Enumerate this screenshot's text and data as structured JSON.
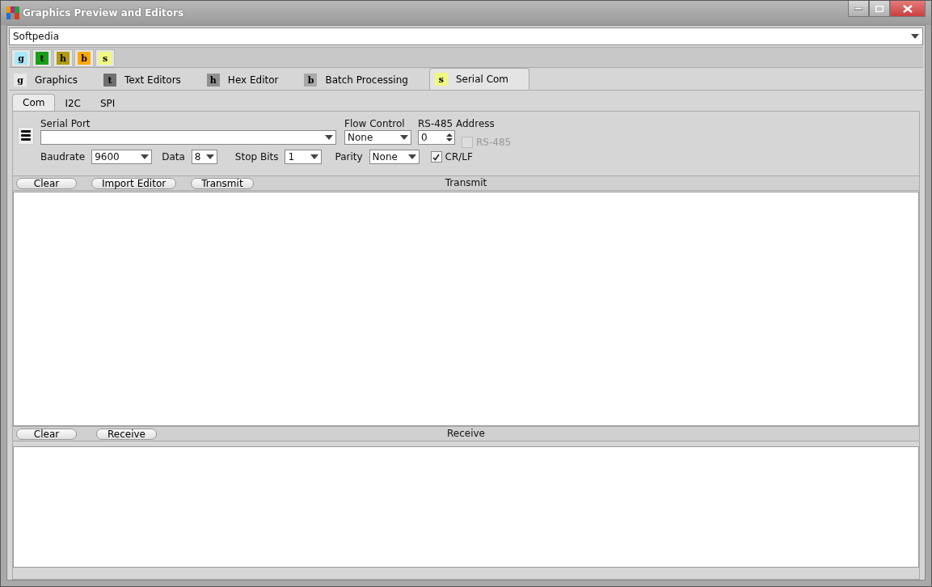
{
  "window": {
    "title": "Graphics Preview and Editors"
  },
  "profile": {
    "value": "Softpedia"
  },
  "toolbar": [
    {
      "letter": "g",
      "color": "#a8e8f8"
    },
    {
      "letter": "t",
      "color": "#18a018"
    },
    {
      "letter": "h",
      "color": "#b09a10"
    },
    {
      "letter": "b",
      "color": "#ffa800"
    },
    {
      "letter": "s",
      "color": "#f0f880"
    }
  ],
  "tabs": [
    {
      "letter": "g",
      "label": "Graphics",
      "color": "#e8e8e8",
      "selected": false
    },
    {
      "letter": "t",
      "label": "Text Editors",
      "color": "#707070",
      "selected": false
    },
    {
      "letter": "h",
      "label": "Hex Editor",
      "color": "#909090",
      "selected": false
    },
    {
      "letter": "b",
      "label": "Batch Processing",
      "color": "#a8a8a8",
      "selected": false
    },
    {
      "letter": "s",
      "label": "Serial Com",
      "color": "#f0f880",
      "selected": true
    }
  ],
  "subtabs": [
    {
      "label": "Com",
      "selected": true
    },
    {
      "label": "I2C",
      "selected": false
    },
    {
      "label": "SPI",
      "selected": false
    }
  ],
  "settings": {
    "serial_port": {
      "label": "Serial Port"
    },
    "flow_control": {
      "label": "Flow Control",
      "value": "None"
    },
    "address": {
      "label": "RS-485 Address",
      "value": "0"
    },
    "rs485": {
      "label": "RS-485",
      "checked": false,
      "disabled": true
    },
    "baudrate": {
      "label": "Baudrate",
      "value": "9600"
    },
    "data": {
      "label": "Data",
      "value": "8"
    },
    "stop_bits": {
      "label": "Stop Bits",
      "value": "1"
    },
    "parity": {
      "label": "Parity",
      "value": "None"
    },
    "crlf": {
      "label": "CR/LF",
      "checked": true,
      "disabled": false
    }
  },
  "transmit": {
    "buttons": [
      "Clear",
      "Import Editor",
      "Transmit"
    ],
    "title": "Transmit"
  },
  "receive": {
    "buttons": [
      "Clear",
      "Receive"
    ],
    "title": "Receive"
  }
}
